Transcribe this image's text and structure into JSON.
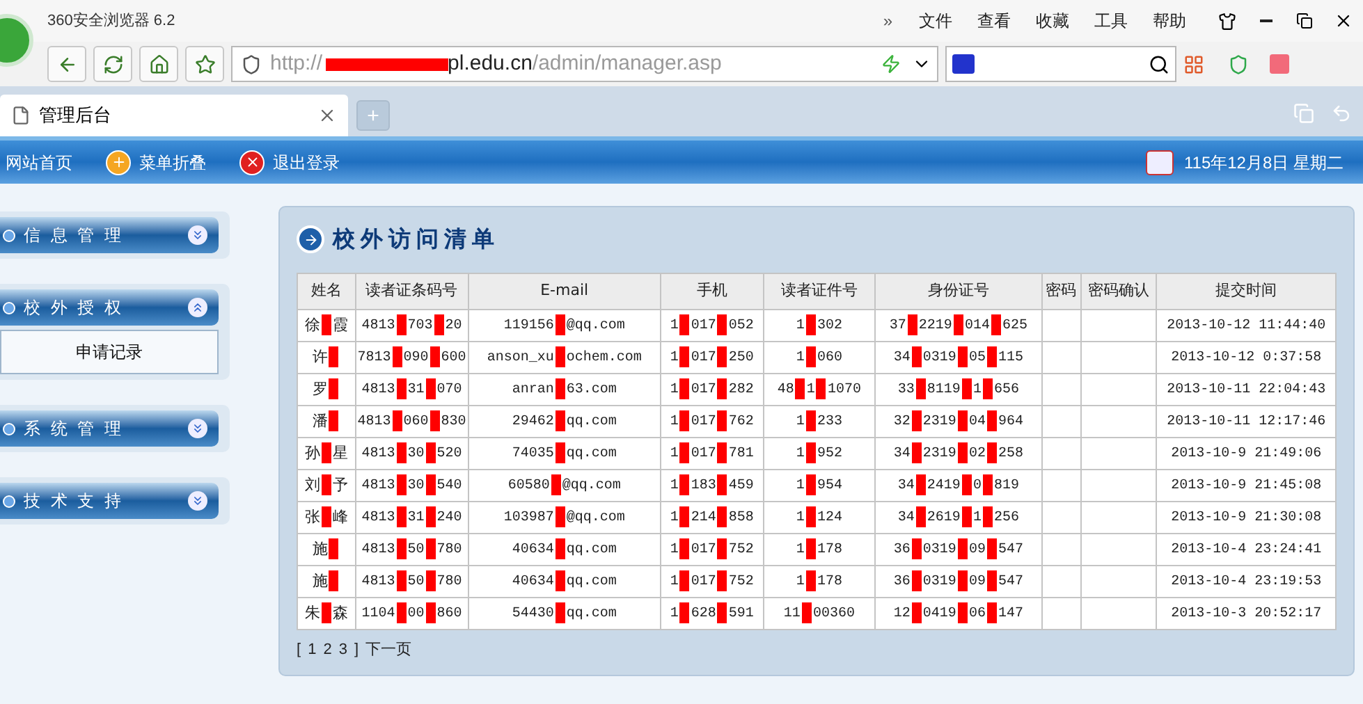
{
  "window": {
    "title": "360安全浏览器 6.2",
    "menu_toggle": "»",
    "menu": [
      "文件",
      "查看",
      "收藏",
      "工具",
      "帮助"
    ]
  },
  "address_bar": {
    "prefix": "http://",
    "host": "pl.edu.cn",
    "path": "/admin/manager.asp"
  },
  "tabs": [
    {
      "label": "管理后台",
      "selected": true
    },
    {
      "label": "+",
      "selected": false
    }
  ],
  "toolbar": {
    "items": [
      {
        "label": "网站首页",
        "kind": "plain"
      },
      {
        "label": "菜单折叠",
        "kind": "fold"
      },
      {
        "label": "退出登录",
        "kind": "logout"
      }
    ],
    "date": "115年12月8日 星期二"
  },
  "sidebar": {
    "groups": [
      {
        "label": "信 息 管 理",
        "expanded": false
      },
      {
        "label": "校 外 授 权",
        "expanded": true,
        "children": [
          "申请记录"
        ]
      },
      {
        "label": "系 统 管 理",
        "expanded": false
      },
      {
        "label": "技 术 支 持",
        "expanded": false
      }
    ]
  },
  "panel": {
    "title": "校外访问清单"
  },
  "table": {
    "columns": [
      "姓名",
      "读者证条码号",
      "E-mail",
      "手机",
      "读者证件号",
      "身份证号",
      "密码",
      "密码确认",
      "提交时间"
    ],
    "rows": [
      {
        "cells": [
          {
            "parts": [
              "徐",
              "霞"
            ]
          },
          {
            "parts": [
              "4813",
              "703",
              "20"
            ]
          },
          {
            "parts": [
              "119156",
              "@qq.com"
            ]
          },
          {
            "parts": [
              "1",
              "017",
              "052"
            ]
          },
          {
            "parts": [
              "1",
              "302"
            ]
          },
          {
            "parts": [
              "37",
              "2219",
              "014",
              "625"
            ]
          },
          {},
          {},
          {
            "parts": [
              "2013-10-12 11:44:40"
            ]
          }
        ]
      },
      {
        "cells": [
          {
            "parts": [
              "许"
            ],
            "tail": true
          },
          {
            "parts": [
              "7813",
              "090",
              "600"
            ]
          },
          {
            "parts": [
              "anson_xu",
              "ochem.com"
            ]
          },
          {
            "parts": [
              "1",
              "017",
              "250"
            ]
          },
          {
            "parts": [
              "1",
              "060"
            ]
          },
          {
            "parts": [
              "34",
              "0319",
              "05",
              "115"
            ]
          },
          {},
          {},
          {
            "parts": [
              "2013-10-12 0:37:58"
            ]
          }
        ]
      },
      {
        "cells": [
          {
            "parts": [
              "罗"
            ],
            "tail": true
          },
          {
            "parts": [
              "4813",
              "31",
              "070"
            ]
          },
          {
            "parts": [
              "anran",
              "63.com"
            ]
          },
          {
            "parts": [
              "1",
              "017",
              "282"
            ]
          },
          {
            "parts": [
              "48",
              "1",
              "1070"
            ]
          },
          {
            "parts": [
              "33",
              "8119",
              "1",
              "656"
            ]
          },
          {},
          {},
          {
            "parts": [
              "2013-10-11 22:04:43"
            ]
          }
        ]
      },
      {
        "cells": [
          {
            "parts": [
              "潘"
            ],
            "tail": true
          },
          {
            "parts": [
              "4813",
              "060",
              "830"
            ]
          },
          {
            "parts": [
              "29462",
              "qq.com"
            ]
          },
          {
            "parts": [
              "1",
              "017",
              "762"
            ]
          },
          {
            "parts": [
              "1",
              "233"
            ]
          },
          {
            "parts": [
              "32",
              "2319",
              "04",
              "964"
            ]
          },
          {},
          {},
          {
            "parts": [
              "2013-10-11 12:17:46"
            ]
          }
        ]
      },
      {
        "cells": [
          {
            "parts": [
              "孙",
              "星"
            ]
          },
          {
            "parts": [
              "4813",
              "30",
              "520"
            ]
          },
          {
            "parts": [
              "74035",
              "qq.com"
            ]
          },
          {
            "parts": [
              "1",
              "017",
              "781"
            ]
          },
          {
            "parts": [
              "1",
              "952"
            ]
          },
          {
            "parts": [
              "34",
              "2319",
              "02",
              "258"
            ]
          },
          {},
          {},
          {
            "parts": [
              "2013-10-9 21:49:06"
            ]
          }
        ]
      },
      {
        "cells": [
          {
            "parts": [
              "刘",
              "予"
            ]
          },
          {
            "parts": [
              "4813",
              "30",
              "540"
            ]
          },
          {
            "parts": [
              "60580",
              "@qq.com"
            ]
          },
          {
            "parts": [
              "1",
              "183",
              "459"
            ]
          },
          {
            "parts": [
              "1",
              "954"
            ]
          },
          {
            "parts": [
              "34",
              "2419",
              "0",
              "819"
            ]
          },
          {},
          {},
          {
            "parts": [
              "2013-10-9 21:45:08"
            ]
          }
        ]
      },
      {
        "cells": [
          {
            "parts": [
              "张",
              "峰"
            ]
          },
          {
            "parts": [
              "4813",
              "31",
              "240"
            ]
          },
          {
            "parts": [
              "103987",
              "@qq.com"
            ]
          },
          {
            "parts": [
              "1",
              "214",
              "858"
            ]
          },
          {
            "parts": [
              "1",
              "124"
            ]
          },
          {
            "parts": [
              "34",
              "2619",
              "1",
              "256"
            ]
          },
          {},
          {},
          {
            "parts": [
              "2013-10-9 21:30:08"
            ]
          }
        ]
      },
      {
        "cells": [
          {
            "parts": [
              "施"
            ],
            "tail": true
          },
          {
            "parts": [
              "4813",
              "50",
              "780"
            ]
          },
          {
            "parts": [
              "40634",
              "qq.com"
            ]
          },
          {
            "parts": [
              "1",
              "017",
              "752"
            ]
          },
          {
            "parts": [
              "1",
              "178"
            ]
          },
          {
            "parts": [
              "36",
              "0319",
              "09",
              "547"
            ]
          },
          {},
          {},
          {
            "parts": [
              "2013-10-4 23:24:41"
            ]
          }
        ]
      },
      {
        "cells": [
          {
            "parts": [
              "施"
            ],
            "tail": true
          },
          {
            "parts": [
              "4813",
              "50",
              "780"
            ]
          },
          {
            "parts": [
              "40634",
              "qq.com"
            ]
          },
          {
            "parts": [
              "1",
              "017",
              "752"
            ]
          },
          {
            "parts": [
              "1",
              "178"
            ]
          },
          {
            "parts": [
              "36",
              "0319",
              "09",
              "547"
            ]
          },
          {},
          {},
          {
            "parts": [
              "2013-10-4 23:19:53"
            ]
          }
        ]
      },
      {
        "cells": [
          {
            "parts": [
              "朱",
              "森"
            ]
          },
          {
            "parts": [
              "1104",
              "00",
              "860"
            ]
          },
          {
            "parts": [
              "54430",
              "qq.com"
            ]
          },
          {
            "parts": [
              "1",
              "628",
              "591"
            ]
          },
          {
            "parts": [
              "11",
              "00360"
            ]
          },
          {
            "parts": [
              "12",
              "0419",
              "06",
              "147"
            ]
          },
          {},
          {},
          {
            "parts": [
              "2013-10-3 20:52:17"
            ]
          }
        ]
      }
    ]
  },
  "pagination": {
    "open": "[",
    "pages": [
      "1",
      "2",
      "3"
    ],
    "close": "]",
    "next": "下一页"
  }
}
